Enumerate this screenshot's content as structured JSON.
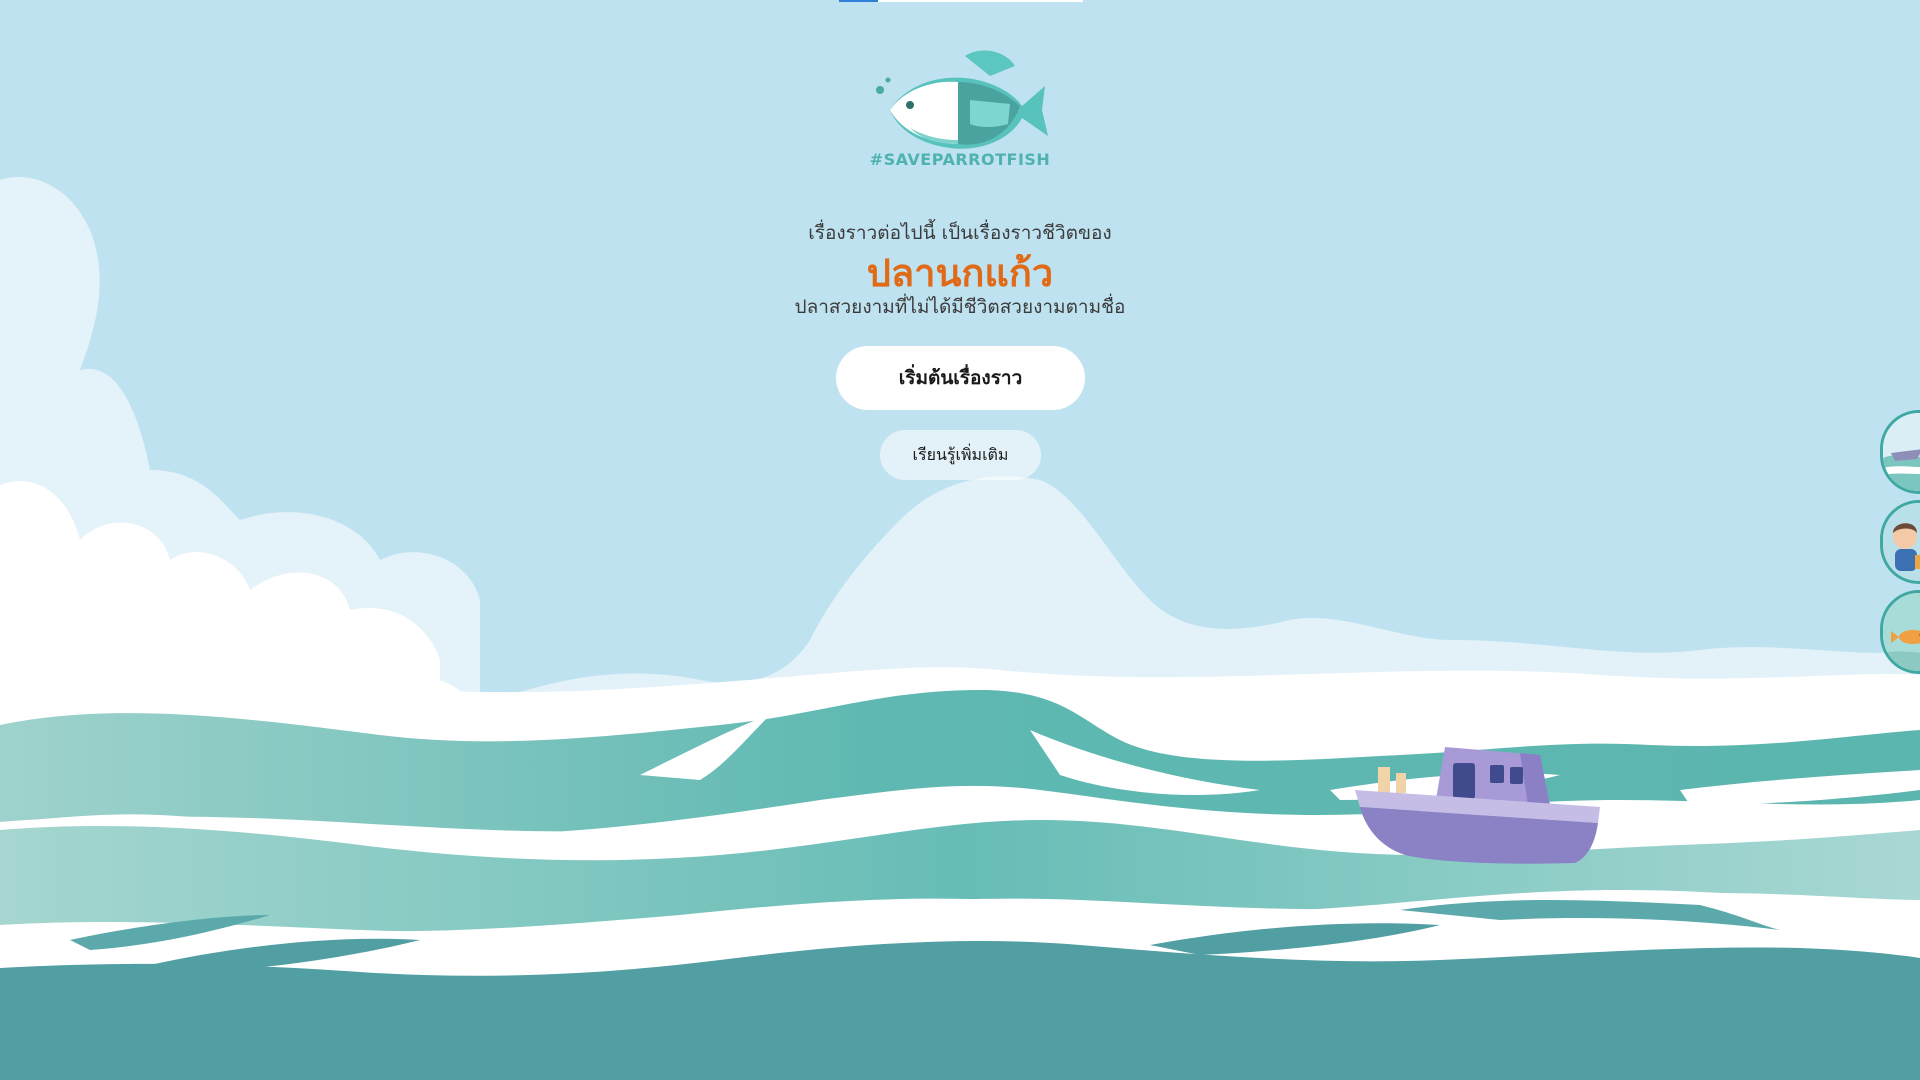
{
  "logo": {
    "icon": "parrot-fish-logo-icon",
    "text": "#SAVEPARROTFISH"
  },
  "progress": {
    "value_fraction": 0.16
  },
  "intro": {
    "line1": "เรื่องราวต่อไปนี้ เป็นเรื่องราวชีวิตของ",
    "title": "ปลานกแก้ว",
    "line2": "ปลาสวยงามที่ไม่ได้มีชีวิตสวยงามตามชื่อ"
  },
  "buttons": {
    "start_label": "เริ่มต้นเรื่องราว",
    "learn_more_label": "เรียนรู้เพิ่มเติม"
  },
  "side_nav": [
    {
      "icon": "boat-wave-thumbnail-icon"
    },
    {
      "icon": "girl-character-thumbnail-icon"
    },
    {
      "icon": "underwater-fish-thumbnail-icon"
    }
  ],
  "colors": {
    "sky": "#bfe2f0",
    "title_orange": "#e06a16",
    "teal": "#5cb8b2",
    "deep_teal": "#4f9fa3",
    "boat_purple": "#8a82c4"
  }
}
